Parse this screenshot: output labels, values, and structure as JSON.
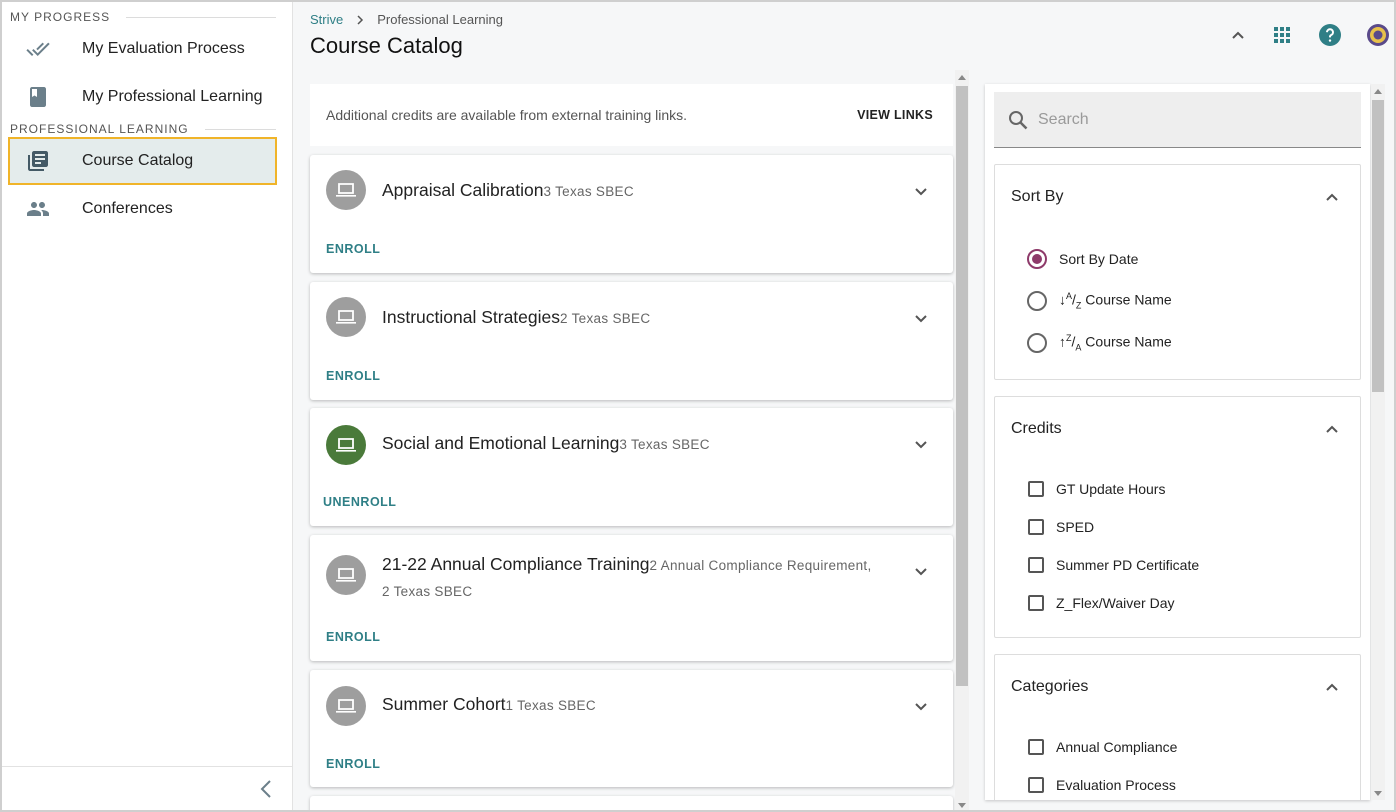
{
  "sidebar": {
    "section_progress": "MY PROGRESS",
    "section_learning": "PROFESSIONAL LEARNING",
    "items": [
      {
        "label": "My Evaluation Process",
        "icon": "double-check-icon"
      },
      {
        "label": "My Professional Learning",
        "icon": "book-icon"
      },
      {
        "label": "Course Catalog",
        "icon": "library-books-icon",
        "active": true
      },
      {
        "label": "Conferences",
        "icon": "people-icon"
      }
    ],
    "collapse_icon": "chevron-left-icon"
  },
  "header": {
    "breadcrumb": [
      "Strive",
      "Professional Learning"
    ],
    "title": "Course Catalog",
    "icons": [
      "chevron-up-icon",
      "apps-grid-icon",
      "help-icon",
      "user-avatar"
    ]
  },
  "notice": {
    "text": "Additional credits are available from external training links.",
    "link": "VIEW LINKS"
  },
  "courses": [
    {
      "title": "Appraisal Calibration",
      "credit": "3 Texas SBEC",
      "action": "ENROLL",
      "enrolled": false
    },
    {
      "title": "Instructional Strategies",
      "credit": "2 Texas SBEC",
      "action": "ENROLL",
      "enrolled": false
    },
    {
      "title": "Social and Emotional Learning",
      "credit": "3 Texas SBEC",
      "action": "UNENROLL",
      "enrolled": true
    },
    {
      "title": "21-22 Annual Compliance Training",
      "credit": "2 Annual Compliance Requirement,",
      "credit2": "2 Texas SBEC",
      "action": "ENROLL",
      "enrolled": false
    },
    {
      "title": "Summer Cohort",
      "credit": "1 Texas SBEC",
      "action": "ENROLL",
      "enrolled": false
    }
  ],
  "filters": {
    "search_placeholder": "Search",
    "sort": {
      "heading": "Sort By",
      "options": [
        {
          "label": "Sort By Date",
          "selected": true
        },
        {
          "prefix": "↓",
          "sup": "A",
          "sep": "/",
          "sub": "Z",
          "label": " Course Name",
          "selected": false
        },
        {
          "prefix": "↑",
          "sup": "Z",
          "sep": "/",
          "sub": "A",
          "label": " Course Name",
          "selected": false
        }
      ]
    },
    "credits": {
      "heading": "Credits",
      "options": [
        "GT Update Hours",
        "SPED",
        "Summer PD Certificate",
        "Z_Flex/Waiver Day"
      ]
    },
    "categories": {
      "heading": "Categories",
      "options": [
        "Annual Compliance",
        "Evaluation Process"
      ]
    }
  },
  "colors": {
    "accent": "#2f7f86",
    "active_border": "#f0b429",
    "radio_selected": "#8e3a6a",
    "enrolled_avatar": "#4a7a3a",
    "default_avatar": "#9e9e9e"
  }
}
